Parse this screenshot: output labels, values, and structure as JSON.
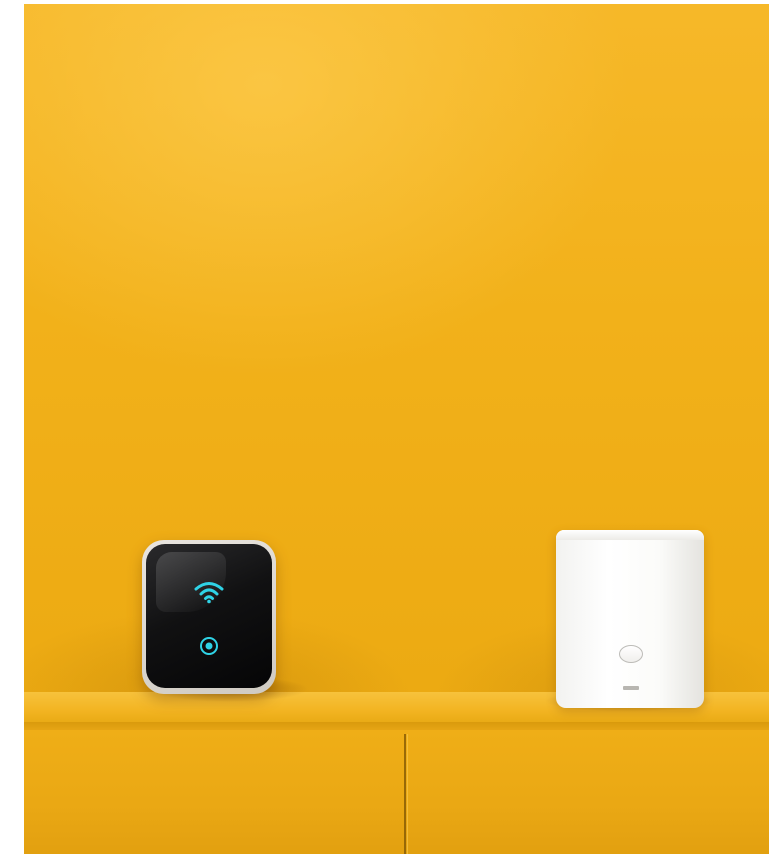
{
  "scene": {
    "description_colors": {
      "wall": "#f2b11a",
      "shelf": "#efae17",
      "dark_device": "#111112",
      "white_device": "#fbfbf9",
      "accent_cyan": "#2fd3e6"
    },
    "icons": {
      "wifi": "wifi-icon",
      "power": "power-icon"
    }
  }
}
